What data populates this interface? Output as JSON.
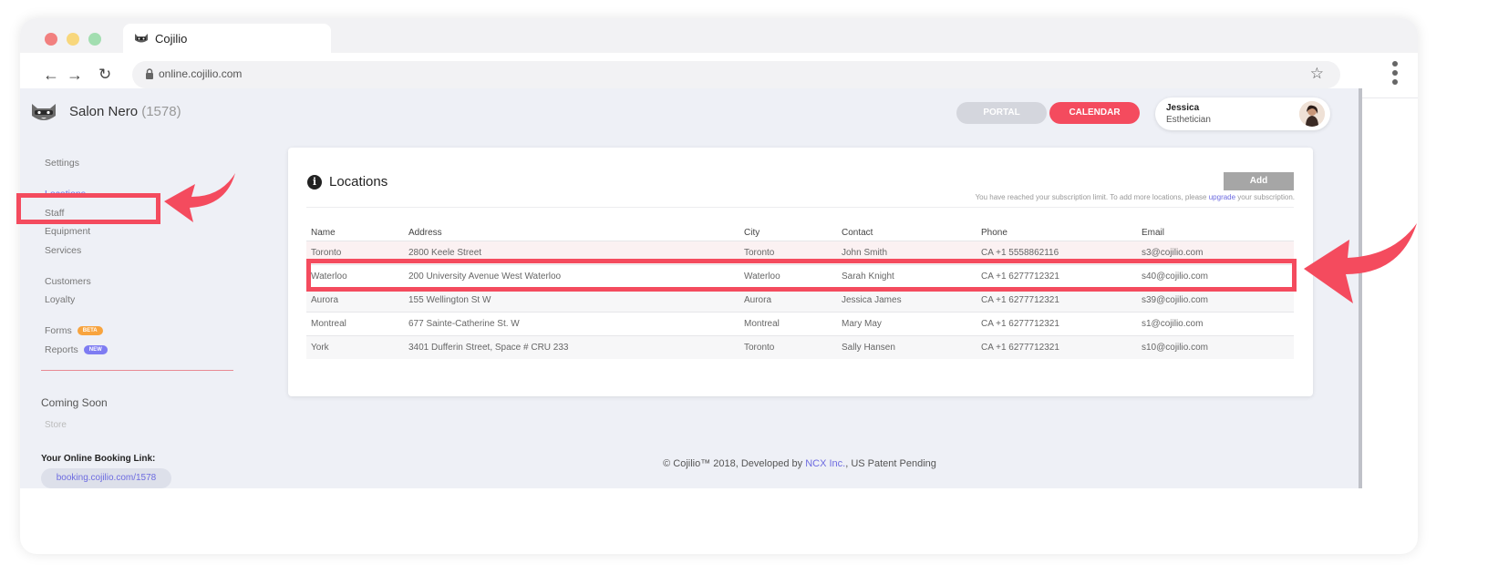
{
  "browser": {
    "tab_title": "Cojilio",
    "url": "online.cojilio.com",
    "icons": {
      "back": "arrow-left-icon",
      "forward": "arrow-right-icon",
      "reload": "reload-icon",
      "lock": "lock-icon",
      "bookmark": "star-icon",
      "menu": "kebab-menu-icon"
    }
  },
  "header": {
    "salon_name": "Salon Nero",
    "salon_id": "(1578)",
    "portal_label": "PORTAL",
    "calendar_label": "CALENDAR",
    "user": {
      "name": "Jessica",
      "role": "Esthetician"
    }
  },
  "sidebar": {
    "items": [
      {
        "label": "Settings",
        "active": false
      },
      {
        "label": "Locations",
        "active": true
      },
      {
        "label": "Staff",
        "active": false
      },
      {
        "label": "Equipment",
        "active": false
      },
      {
        "label": "Services",
        "active": false
      },
      {
        "label": "Customers",
        "active": false
      },
      {
        "label": "Loyalty",
        "active": false
      },
      {
        "label": "Forms",
        "badge": "BETA",
        "active": false
      },
      {
        "label": "Reports",
        "badge": "NEW",
        "active": false
      }
    ],
    "coming_soon_title": "Coming Soon",
    "coming_soon_items": [
      "Store"
    ],
    "booking_label": "Your Online Booking Link:",
    "booking_link": "booking.cojilio.com/1578"
  },
  "main": {
    "title": "Locations",
    "add_label": "Add",
    "limit_note_prefix": "You have reached your subscription limit. To add more locations, please ",
    "limit_note_link": "upgrade",
    "limit_note_suffix": " your subscription.",
    "table": {
      "columns": [
        "Name",
        "Address",
        "City",
        "Contact",
        "Phone",
        "Email"
      ],
      "rows": [
        [
          "Toronto",
          "2800 Keele Street",
          "Toronto",
          "John Smith",
          "CA +1 5558862116",
          "s3@cojilio.com"
        ],
        [
          "Waterloo",
          "200 University Avenue West Waterloo",
          "Waterloo",
          "Sarah Knight",
          "CA +1 6277712321",
          "s40@cojilio.com"
        ],
        [
          "Aurora",
          "155 Wellington St W",
          "Aurora",
          "Jessica James",
          "CA +1 6277712321",
          "s39@cojilio.com"
        ],
        [
          "Montreal",
          "677 Sainte-Catherine St. W",
          "Montreal",
          "Mary May",
          "CA +1 6277712321",
          "s1@cojilio.com"
        ],
        [
          "York",
          "3401 Dufferin Street, Space # CRU 233",
          "Toronto",
          "Sally Hansen",
          "CA +1 6277712321",
          "s10@cojilio.com"
        ]
      ],
      "selected_row": 0
    }
  },
  "footer": {
    "prefix": "© Cojilio™ 2018, Developed by ",
    "company": "NCX Inc.",
    "suffix": ", US Patent Pending"
  },
  "colors": {
    "accent": "#f44b5e",
    "link": "#6d6be0",
    "beta_badge": "#f8a43e",
    "new_badge": "#7e7cf2",
    "app_background": "#eef0f6"
  }
}
